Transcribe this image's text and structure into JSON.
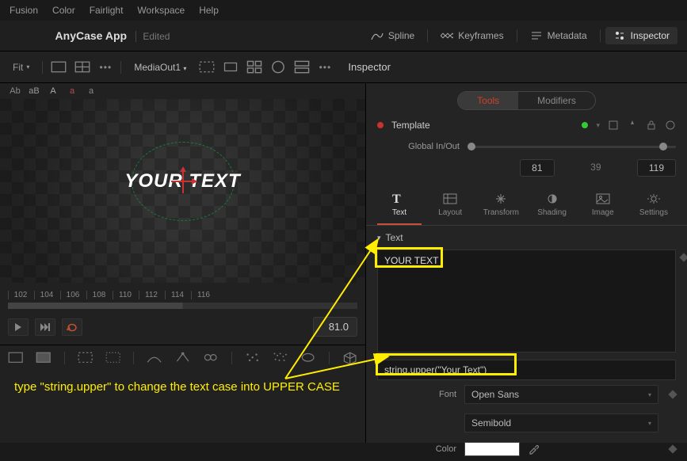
{
  "menu": {
    "items": [
      "Fusion",
      "Color",
      "Fairlight",
      "Workspace",
      "Help"
    ]
  },
  "title": {
    "app": "AnyCase App",
    "status": "Edited"
  },
  "title_buttons": {
    "spline": "Spline",
    "keyframes": "Keyframes",
    "metadata": "Metadata",
    "inspector": "Inspector"
  },
  "toolbar": {
    "fit": "Fit",
    "media_out": "MediaOut1"
  },
  "inspector_header": "Inspector",
  "channels": [
    "Ab",
    "aB",
    "A",
    "a",
    "a"
  ],
  "viewer_text": "YOUR TEXT",
  "ruler_ticks": [
    "102",
    "104",
    "106",
    "108",
    "110",
    "112",
    "114",
    "116"
  ],
  "transport": {
    "timecode": "81.0"
  },
  "inspector": {
    "tabs": {
      "tools": "Tools",
      "modifiers": "Modifiers"
    },
    "template": "Template",
    "global_label": "Global In/Out",
    "in": "81",
    "dur": "39",
    "out": "119",
    "cats": {
      "text": "Text",
      "layout": "Layout",
      "transform": "Transform",
      "shading": "Shading",
      "image": "Image",
      "settings": "Settings"
    },
    "section_text": "Text",
    "text_value": "YOUR TEXT",
    "expr_value": "string.upper(\"Your Text\")",
    "font_label": "Font",
    "font_value": "Open Sans",
    "weight_value": "Semibold",
    "color_label": "Color"
  },
  "annotation": {
    "caption": "type \"string.upper\" to change the text case into UPPER CASE"
  }
}
